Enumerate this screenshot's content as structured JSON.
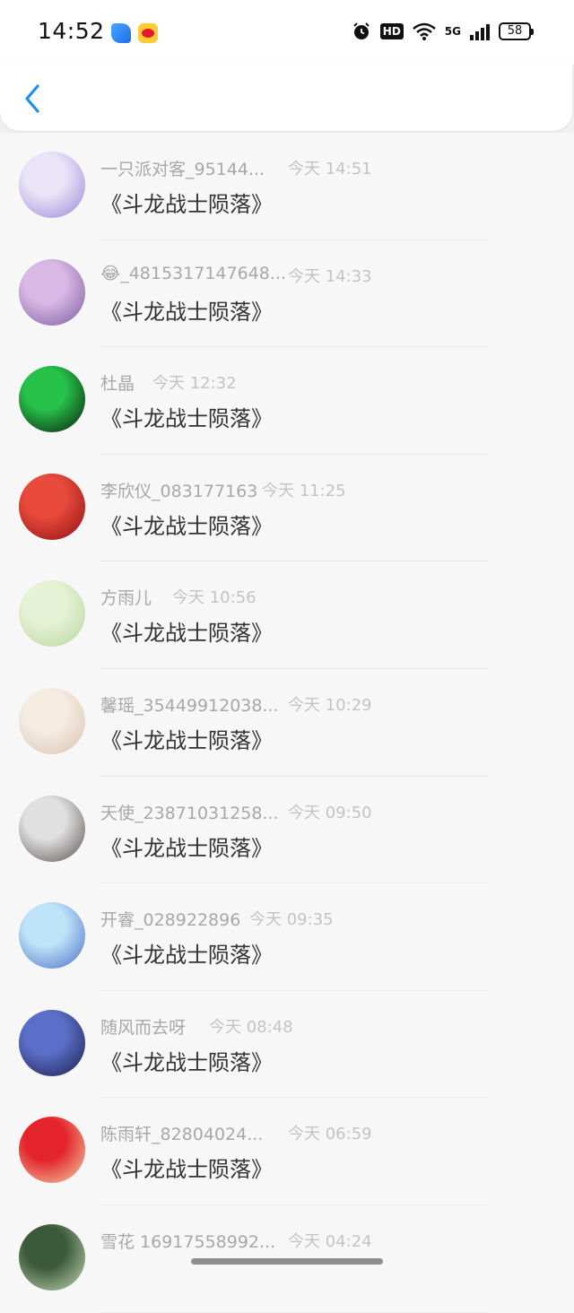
{
  "status_bar": {
    "time": "14:52",
    "battery": "58",
    "hd_label": "HD",
    "network_label": "5G"
  },
  "items": [
    {
      "name": "一只派对客_95144...",
      "time": "今天 14:51",
      "message": "《斗龙战士陨落》",
      "avatar_colors": [
        "#e9e4f7",
        "#9a86d6"
      ]
    },
    {
      "name": "😂_4815317147648...",
      "time": "今天 14:33",
      "message": "《斗龙战士陨落》",
      "avatar_colors": [
        "#d9b8e6",
        "#7a5b9a"
      ]
    },
    {
      "name": "杜晶",
      "time": "今天 12:32",
      "message": "《斗龙战士陨落》",
      "avatar_colors": [
        "#26c24a",
        "#0a1a0c"
      ]
    },
    {
      "name": "李欣仪_083177163",
      "time": "今天 11:25",
      "message": "《斗龙战士陨落》",
      "avatar_colors": [
        "#e84a3c",
        "#8c1010"
      ]
    },
    {
      "name": "方雨儿",
      "time": "今天 10:56",
      "message": "《斗龙战士陨落》",
      "avatar_colors": [
        "#e6f2d6",
        "#b7d69e"
      ]
    },
    {
      "name": "馨瑶_35449912038...",
      "time": "今天 10:29",
      "message": "《斗龙战士陨落》",
      "avatar_colors": [
        "#f5ece2",
        "#d8c3b3"
      ]
    },
    {
      "name": "天使_23871031258...",
      "time": "今天 09:50",
      "message": "《斗龙战士陨落》",
      "avatar_colors": [
        "#e0e0e0",
        "#5a5050"
      ]
    },
    {
      "name": "开睿_028922896",
      "time": "今天 09:35",
      "message": "《斗龙战士陨落》",
      "avatar_colors": [
        "#bfe3f7",
        "#4a6ec8"
      ]
    },
    {
      "name": "随风而去呀",
      "time": "今天 08:48",
      "message": "《斗龙战士陨落》",
      "avatar_colors": [
        "#5c6fc8",
        "#1a1f4a"
      ]
    },
    {
      "name": "陈雨轩_82804024...",
      "time": "今天 06:59",
      "message": "《斗龙战士陨落》",
      "avatar_colors": [
        "#e3242b",
        "#f5d3a8"
      ]
    },
    {
      "name": "雪花 16917558992...",
      "time": "今天 04:24",
      "message": "",
      "avatar_colors": [
        "#3a5a3a",
        "#c8d8b8"
      ]
    }
  ]
}
